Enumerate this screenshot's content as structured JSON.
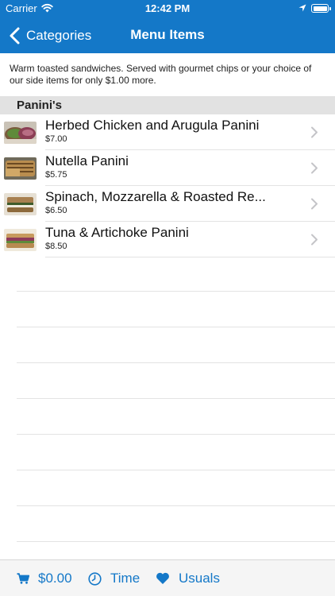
{
  "status_bar": {
    "carrier": "Carrier",
    "time": "12:42 PM"
  },
  "nav": {
    "back_label": "Categories",
    "title": "Menu Items"
  },
  "description": "Warm toasted sandwiches.  Served with gourmet chips or your choice of our side items for only $1.00 more.",
  "section": {
    "title": "Panini's"
  },
  "items": [
    {
      "name": "Herbed Chicken and Arugula Panini",
      "price": "$7.00"
    },
    {
      "name": "Nutella Panini",
      "price": "$5.75"
    },
    {
      "name": "Spinach, Mozzarella & Roasted Re...",
      "price": "$6.50"
    },
    {
      "name": "Tuna & Artichoke Panini",
      "price": "$8.50"
    }
  ],
  "tabbar": {
    "cart_total": "$0.00",
    "time_label": "Time",
    "usuals_label": "Usuals"
  },
  "colors": {
    "accent": "#1478c8",
    "section_bg": "#e2e2e2"
  }
}
